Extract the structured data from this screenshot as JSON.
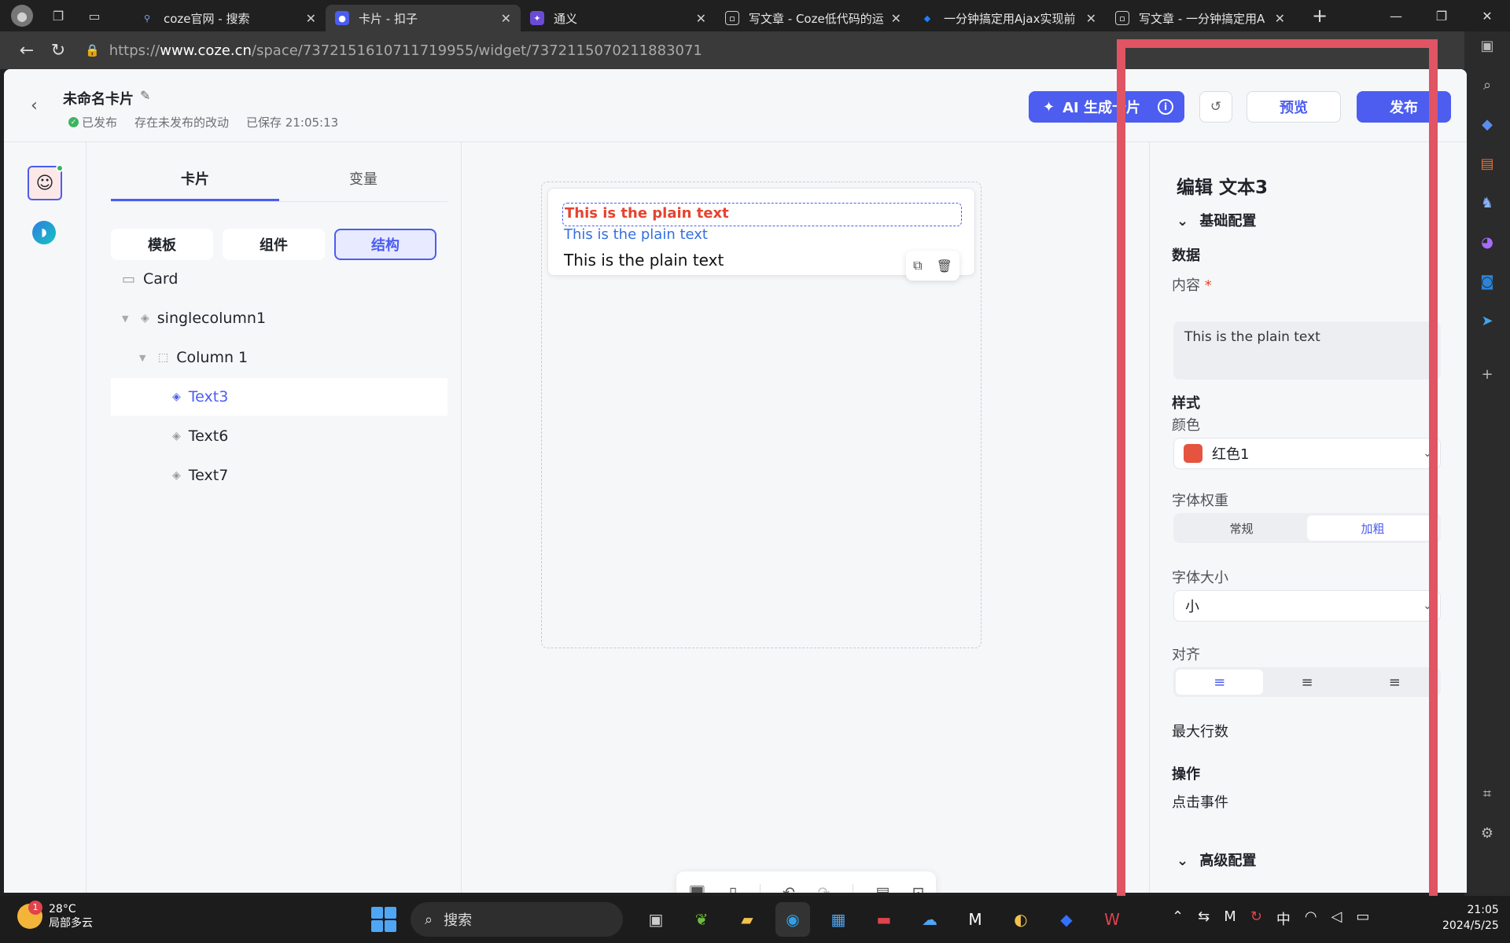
{
  "browser": {
    "tabs": [
      {
        "title": "coze官网 - 搜索",
        "icon": "search-icon",
        "color": "#2b2b2b"
      },
      {
        "title": "卡片 - 扣子",
        "icon": "coze-icon",
        "color": "#4c5df0"
      },
      {
        "title": "通义",
        "icon": "tongyi-icon",
        "color": "#6b4bd6"
      },
      {
        "title": "写文章 - Coze低代码的运",
        "icon": "page-icon",
        "color": "#2b2b2b"
      },
      {
        "title": "一分钟搞定用Ajax实现前",
        "icon": "juejin-icon",
        "color": "#1e80ff"
      },
      {
        "title": "写文章 - 一分钟搞定用A",
        "icon": "page-icon",
        "color": "#2b2b2b"
      }
    ],
    "url_prefix": "https://",
    "url_host": "www.coze.cn",
    "url_path": "/space/7372151610711719955/widget/7372115070211883071"
  },
  "header": {
    "card_name": "未命名卡片",
    "published": "已发布",
    "unpublished_changes": "存在未发布的改动",
    "saved": "已保存 21:05:13",
    "ai_button": "AI 生成卡片",
    "preview": "预览",
    "publish": "发布"
  },
  "left_panel": {
    "tabs": [
      "卡片",
      "变量"
    ],
    "segments": [
      "模板",
      "组件",
      "结构"
    ],
    "tree": [
      {
        "label": "Card",
        "icon": "card-icon"
      },
      {
        "label": "singlecolumn1",
        "icon": "layers-icon"
      },
      {
        "label": "Column 1",
        "icon": "column-icon"
      },
      {
        "label": "Text3",
        "icon": "layers-icon"
      },
      {
        "label": "Text6",
        "icon": "layers-icon"
      },
      {
        "label": "Text7",
        "icon": "layers-icon"
      }
    ]
  },
  "canvas": {
    "text1": "This is the plain text",
    "text2": "This is the plain text",
    "text3": "This is the plain text"
  },
  "right_panel": {
    "title": "编辑 文本3",
    "basic_config": "基础配置",
    "data_heading": "数据",
    "content_label": "内容",
    "required_mark": "*",
    "content_value": "This is the plain text",
    "style_heading": "样式",
    "color_label": "颜色",
    "color_value": "红色1",
    "color_hex": "#e5543f",
    "weight_label": "字体权重",
    "weight_options": [
      "常规",
      "加粗"
    ],
    "size_label": "字体大小",
    "size_value": "小",
    "align_label": "对齐",
    "max_lines_label": "最大行数",
    "action_heading": "操作",
    "click_event_label": "点击事件",
    "advanced_config": "高级配置"
  },
  "taskbar": {
    "temperature": "28°C",
    "weather": "局部多云",
    "weather_badge": "1",
    "search": "搜索",
    "ime": "中",
    "time": "21:05",
    "date": "2024/5/25"
  }
}
